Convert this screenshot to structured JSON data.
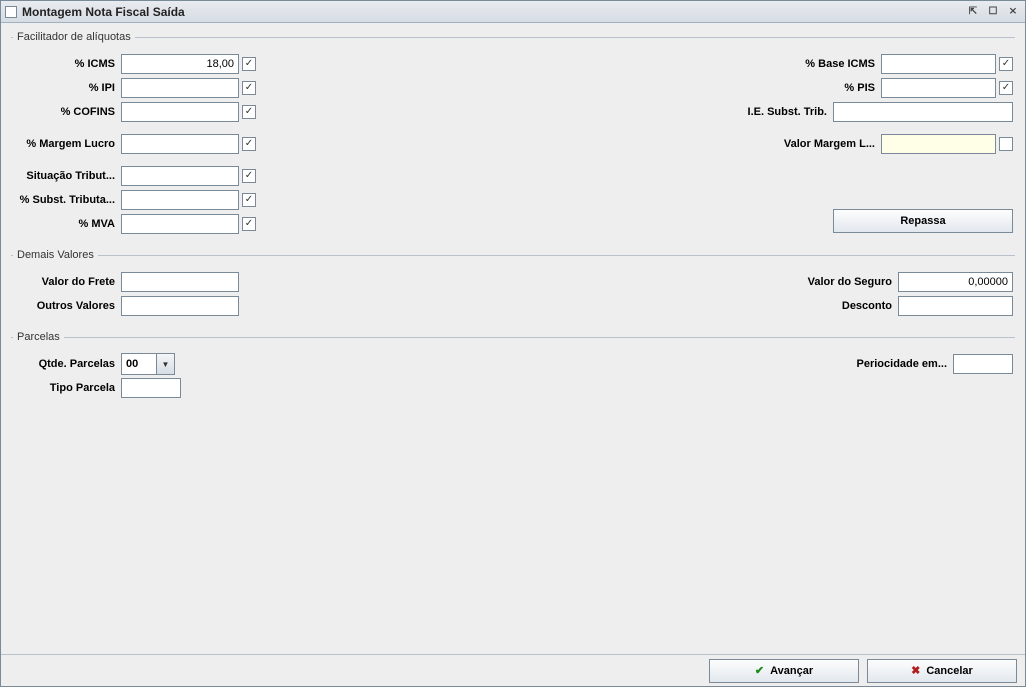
{
  "title": "Montagem Nota Fiscal Saída",
  "groups": {
    "facilitador": "Facilitador de alíquotas",
    "demais": "Demais Valores",
    "parcelas": "Parcelas"
  },
  "left": {
    "icms_label": "% ICMS",
    "icms_value": "18,00",
    "icms_checked": true,
    "ipi_label": "% IPI",
    "ipi_value": "",
    "ipi_checked": true,
    "cofins_label": "% COFINS",
    "cofins_value": "",
    "cofins_checked": true,
    "margem_label": "% Margem Lucro",
    "margem_value": "",
    "margem_checked": true,
    "sit_label": "Situação Tribut...",
    "sit_value": "",
    "sit_checked": true,
    "subst_label": "% Subst. Tributa...",
    "subst_value": "",
    "subst_checked": true,
    "mva_label": "% MVA",
    "mva_value": "",
    "mva_checked": true
  },
  "right": {
    "baseicms_label": "% Base ICMS",
    "baseicms_value": "",
    "baseicms_checked": true,
    "pis_label": "% PIS",
    "pis_value": "",
    "pis_checked": true,
    "ie_label": "I.E. Subst. Trib.",
    "ie_value": "",
    "valormargem_label": "Valor Margem L...",
    "valormargem_value": "",
    "valormargem_checked": false,
    "repassa_btn": "Repassa"
  },
  "demais": {
    "frete_label": "Valor do Frete",
    "frete_value": "",
    "outros_label": "Outros Valores",
    "outros_value": "",
    "seguro_label": "Valor do Seguro",
    "seguro_value": "0,00000",
    "desconto_label": "Desconto",
    "desconto_value": ""
  },
  "parcelas": {
    "qtde_label": "Qtde. Parcelas",
    "qtde_value": "00",
    "tipo_label": "Tipo Parcela",
    "tipo_value": "",
    "period_label": "Periocidade em...",
    "period_value": ""
  },
  "footer": {
    "avancar": "Avançar",
    "cancelar": "Cancelar"
  }
}
